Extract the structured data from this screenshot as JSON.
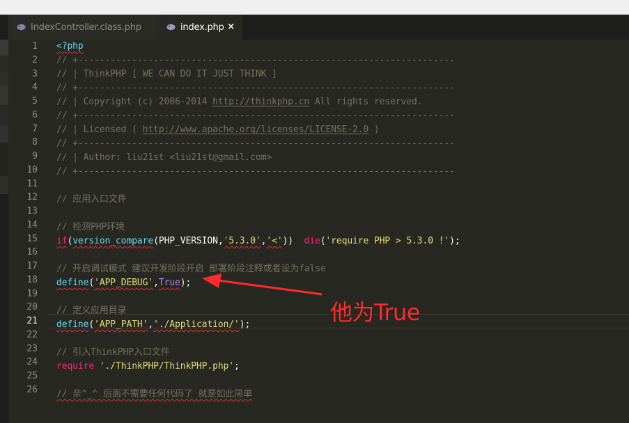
{
  "tabs": [
    {
      "label": "IndexController.class.php",
      "active": false,
      "icon": "php-elephant-icon"
    },
    {
      "label": "index.php",
      "active": true,
      "icon": "php-elephant-icon",
      "close": "×"
    }
  ],
  "editor": {
    "current_line": 21,
    "line_numbers": [
      "1",
      "2",
      "3",
      "4",
      "5",
      "6",
      "7",
      "8",
      "9",
      "10",
      "11",
      "12",
      "13",
      "14",
      "15",
      "16",
      "17",
      "18",
      "19",
      "20",
      "21",
      "22",
      "23",
      "24",
      "25",
      "26"
    ]
  },
  "code": {
    "l1": {
      "a": "<?php"
    },
    "l2": {
      "a": "// +----------------------------------------------------------------------"
    },
    "l3": {
      "a": "// | ThinkPHP [ WE CAN DO IT JUST THINK ]"
    },
    "l4": {
      "a": "// +----------------------------------------------------------------------"
    },
    "l5": {
      "a": "// | Copyright (c) 2006-2014 ",
      "link": "http://thinkphp.cn",
      "b": " All rights reserved."
    },
    "l6": {
      "a": "// +----------------------------------------------------------------------"
    },
    "l7": {
      "a": "// | Licensed ( ",
      "link": "http://www.apache.org/licenses/LICENSE-2.0",
      "b": " )"
    },
    "l8": {
      "a": "// +----------------------------------------------------------------------"
    },
    "l9": {
      "a": "// | Author: liu21st <liu21st@gmail.com>"
    },
    "l10": {
      "a": "// +----------------------------------------------------------------------"
    },
    "l12": {
      "a": "// 应用入口文件"
    },
    "l14": {
      "a": "// 检测PHP环境"
    },
    "l15": {
      "kw": "if",
      "p1": "(",
      "fn": "version_compare",
      "p2": "(PHP_VERSION,",
      "s1": "'5.3.0'",
      "c1": ",",
      "s2": "'<'",
      "p3": "))  ",
      "die": "die",
      "p4": "(",
      "s3": "'require PHP > 5.3.0 !'",
      "p5": ");"
    },
    "l17": {
      "a": "// 开启调试模式 建议开发阶段开启 部署阶段注释或者设为false"
    },
    "l18": {
      "fn": "define",
      "p1": "(",
      "s1": "'APP_DEBUG'",
      "c1": ",",
      "cst": "True",
      "p2": ");"
    },
    "l20": {
      "a": "// 定义应用目录"
    },
    "l21": {
      "fn": "define",
      "p1": "(",
      "s1": "'APP_PATH'",
      "c1": ",",
      "s2": "'./Application/'",
      "p2": ");"
    },
    "l23": {
      "a": "// 引入ThinkPHP入口文件"
    },
    "l24": {
      "kw": "require",
      "sp": " ",
      "s1": "'./ThinkPHP/ThinkPHP.php'",
      "p1": ";"
    },
    "l26": {
      "a": "// 亲^_^ 后面不需要任何代码了 就是如此简单"
    }
  },
  "annotation": {
    "text": "他为True",
    "color": "#ff2a2a"
  },
  "colors": {
    "background": "#272822",
    "comment": "#75715e",
    "string": "#e6db74",
    "keyword": "#f92672",
    "function": "#66d9ef",
    "constant": "#ae81ff"
  }
}
